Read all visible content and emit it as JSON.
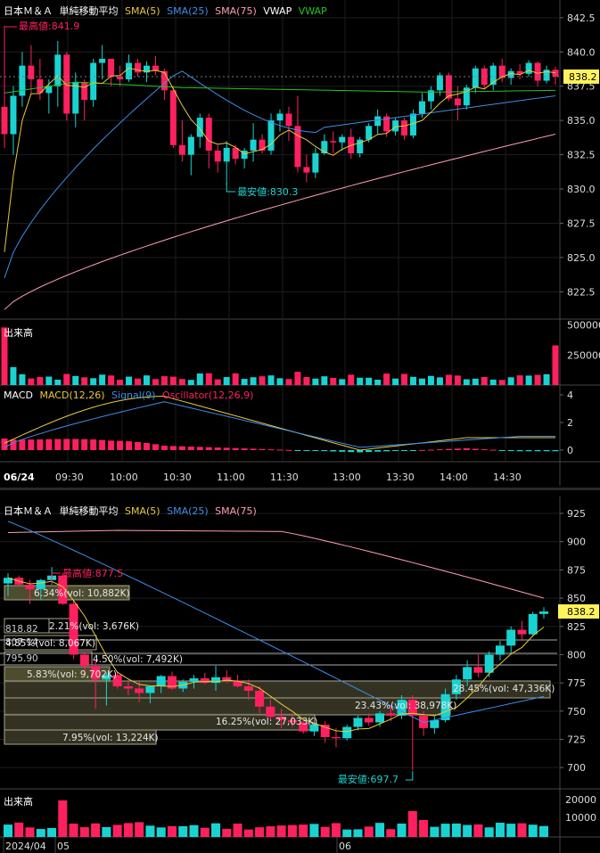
{
  "intraday": {
    "legend": {
      "name": "日本Ｍ＆Ａ",
      "ma_label": "単純移動平均",
      "sma5": "SMA(5)",
      "sma25": "SMA(25)",
      "sma75": "SMA(75)",
      "vwap": "VWAP"
    },
    "high_label": "最高値:841.9",
    "low_label": "最安値:830.3",
    "price_badge": "838.2",
    "volume_title": "出来高",
    "macd_legend": {
      "macd": "MACD",
      "macd_params": "MACD(12,26)",
      "signal": "Signal(9)",
      "osc": "Oscillator(12,26,9)"
    },
    "date_label": "06/24",
    "time_labels": [
      "09:30",
      "10:00",
      "10:30",
      "11:00",
      "11:30",
      "13:00",
      "13:30",
      "14:00",
      "14:30"
    ],
    "price_axis": [
      "842.5",
      "840.0",
      "837.5",
      "835.0",
      "832.5",
      "830.0",
      "827.5",
      "825.0",
      "822.5"
    ],
    "volume_axis": [
      "500000",
      "250000"
    ],
    "macd_axis": [
      "4",
      "2",
      "0"
    ]
  },
  "daily": {
    "legend": {
      "name": "日本Ｍ＆Ａ",
      "ma_label": "単純移動平均",
      "sma5": "SMA(5)",
      "sma25": "SMA(25)",
      "sma75": "SMA(75)"
    },
    "high_label": "最高値:877.5",
    "low_label": "最安値:697.7",
    "price_badge": "838.2",
    "price_axis": [
      "925",
      "900",
      "875",
      "850",
      "825",
      "800",
      "775",
      "750",
      "725",
      "700"
    ],
    "volume_title": "出来高",
    "volume_axis": [
      "20000",
      "10000"
    ],
    "date_labels": [
      "2024/04",
      "05",
      "06"
    ],
    "profile_labels": [
      "6.34%(vol: 10,882K)",
      "2.21%(vol: 3,676K)",
      "4.85%(vol: 8,067K)",
      "4.50%(vol: 7,492K)",
      "5.83%(vol: 9,702K)",
      "16.25%(vol: 27,033K)",
      "7.95%(vol: 13,224K)",
      "23.43%(vol: 38,978K)",
      "28.45%(vol: 47,336K)"
    ],
    "fib_labels": [
      "818.82",
      "807.14",
      "795.90"
    ]
  },
  "colors": {
    "up": "#19d3d3",
    "down": "#ff2060",
    "sma5": "#e8c93a",
    "sma25": "#3c8fe8",
    "sma75": "#ff9fb0",
    "vwap": "#23c423",
    "badge": "#fff45a"
  }
}
